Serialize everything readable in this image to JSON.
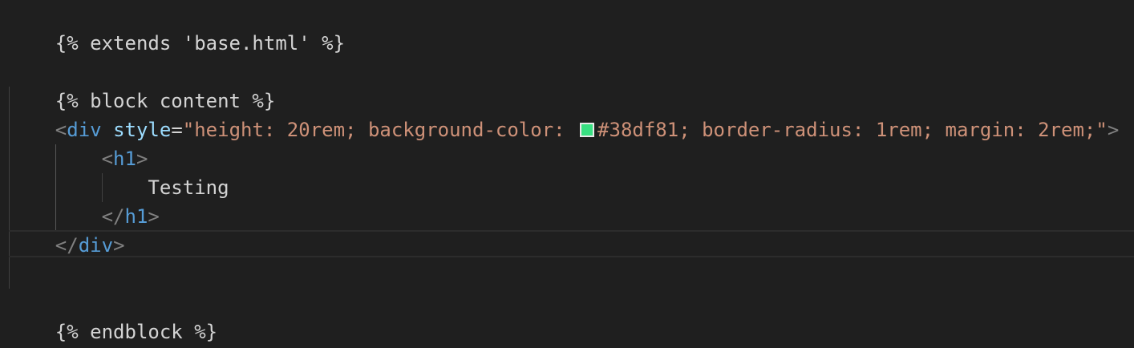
{
  "code": {
    "line1": "{% extends 'base.html' %}",
    "line3": "{% block content %}",
    "div_open_lt": "<",
    "div_tag": "div",
    "style_attr": "style",
    "equals": "=",
    "style_value_start": "\"height: 20rem; background-color: ",
    "style_value_end": "#38df81; border-radius: 1rem; margin: 2rem;\"",
    "div_open_gt": ">",
    "h1_open_lt": "<",
    "h1_tag": "h1",
    "h1_open_gt": ">",
    "text_content": "Testing",
    "h1_close_lt": "</",
    "h1_close_gt": ">",
    "div_close_lt": "</",
    "div_close_gt": ">",
    "line11": "{% endblock %}"
  },
  "colors": {
    "background": "#1f1f1f",
    "swatch": "#38df81",
    "tag": "#569cd6",
    "attribute": "#9cdcfe",
    "string": "#ce9178"
  },
  "icons": {
    "color_swatch": "color-swatch-icon"
  }
}
